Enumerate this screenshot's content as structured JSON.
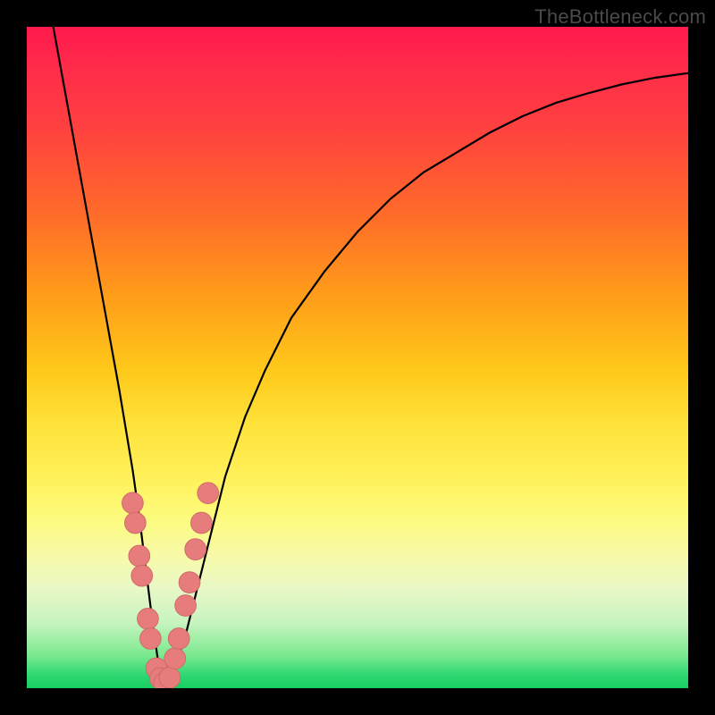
{
  "watermark": "TheBottleneck.com",
  "colors": {
    "frame": "#000000",
    "curve": "#000000",
    "dot_fill": "#e77c7c",
    "dot_stroke": "#d06a6a",
    "gradient_top": "#ff1a4d",
    "gradient_bottom": "#17cf62"
  },
  "chart_data": {
    "type": "line",
    "title": "",
    "xlabel": "",
    "ylabel": "",
    "xlim": [
      0,
      100
    ],
    "ylim": [
      0,
      100
    ],
    "grid": false,
    "legend_position": "none",
    "annotations": [
      "TheBottleneck.com"
    ],
    "series": [
      {
        "name": "bottleneck-curve",
        "x": [
          4,
          6,
          8,
          10,
          12,
          14,
          16,
          17,
          18,
          19,
          20,
          21,
          22,
          24,
          26,
          28,
          30,
          33,
          36,
          40,
          45,
          50,
          55,
          60,
          65,
          70,
          75,
          80,
          85,
          90,
          95,
          100
        ],
        "y": [
          100,
          89,
          78,
          67,
          56,
          45,
          33,
          26,
          18,
          10,
          3,
          0,
          2,
          8,
          16,
          24,
          32,
          41,
          48,
          56,
          63,
          69,
          74,
          78,
          81,
          84,
          86.5,
          88.5,
          90,
          91.3,
          92.3,
          93
        ]
      }
    ],
    "dots": [
      {
        "x": 16.0,
        "y": 28.0
      },
      {
        "x": 16.4,
        "y": 25.0
      },
      {
        "x": 17.0,
        "y": 20.0
      },
      {
        "x": 17.4,
        "y": 17.0
      },
      {
        "x": 18.3,
        "y": 10.5
      },
      {
        "x": 18.7,
        "y": 7.5
      },
      {
        "x": 19.6,
        "y": 3.0
      },
      {
        "x": 20.2,
        "y": 1.5
      },
      {
        "x": 20.8,
        "y": 0.8
      },
      {
        "x": 21.6,
        "y": 1.6
      },
      {
        "x": 22.4,
        "y": 4.5
      },
      {
        "x": 23.0,
        "y": 7.5
      },
      {
        "x": 24.0,
        "y": 12.5
      },
      {
        "x": 24.6,
        "y": 16.0
      },
      {
        "x": 25.5,
        "y": 21.0
      },
      {
        "x": 26.4,
        "y": 25.0
      },
      {
        "x": 27.4,
        "y": 29.5
      }
    ],
    "dot_radius_frac": 0.016
  }
}
